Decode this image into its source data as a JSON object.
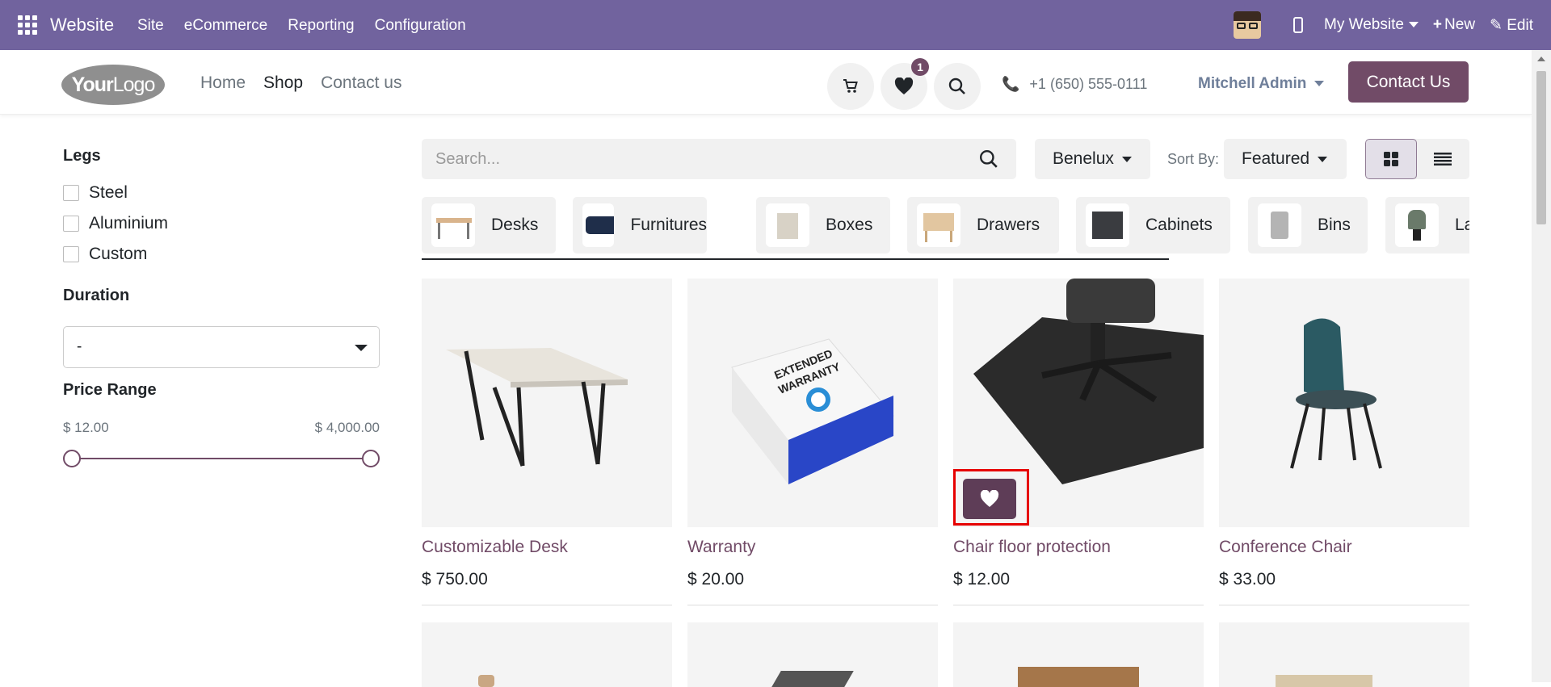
{
  "topbar": {
    "title": "Website",
    "menu": [
      "Site",
      "eCommerce",
      "Reporting",
      "Configuration"
    ],
    "website_selector": "My Website",
    "new_label": "New",
    "edit_label": "Edit"
  },
  "header": {
    "logo_text_bold": "Your",
    "logo_text": "Logo",
    "nav": [
      "Home",
      "Shop",
      "Contact us"
    ],
    "active_nav": "Shop",
    "wishlist_count": "1",
    "phone": "+1 (650) 555-0111",
    "user": "Mitchell Admin",
    "contact_button": "Contact Us"
  },
  "filters": {
    "legs_title": "Legs",
    "legs_options": [
      "Steel",
      "Aluminium",
      "Custom"
    ],
    "duration_title": "Duration",
    "duration_value": "-",
    "price_title": "Price Range",
    "price_min": "$ 12.00",
    "price_max": "$ 4,000.00"
  },
  "toolbar": {
    "search_placeholder": "Search...",
    "pricelist": "Benelux",
    "sort_label": "Sort By:",
    "sort_value": "Featured"
  },
  "categories": [
    "Desks",
    "Furnitures",
    "Boxes",
    "Drawers",
    "Cabinets",
    "Bins",
    "La"
  ],
  "products": [
    {
      "name": "Customizable Desk",
      "price": "$ 750.00"
    },
    {
      "name": "Warranty",
      "price": "$ 20.00"
    },
    {
      "name": "Chair floor protection",
      "price": "$ 12.00"
    },
    {
      "name": "Conference Chair",
      "price": "$ 33.00"
    }
  ],
  "warranty_box": {
    "line1": "EXTENDED",
    "line2": "WARRANTY"
  },
  "colors": {
    "admin_bar": "#71639e",
    "brand": "#714b67",
    "highlight": "#e60000"
  }
}
